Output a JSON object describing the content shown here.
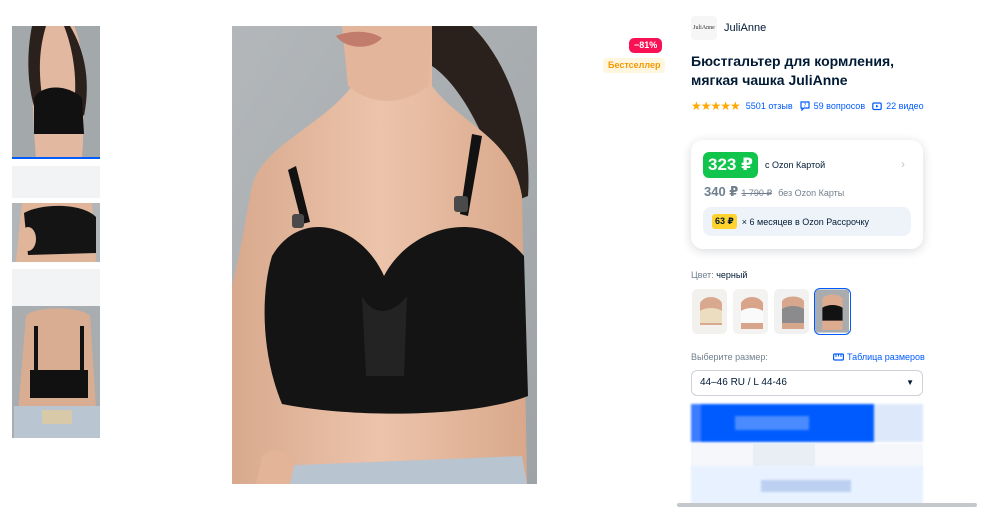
{
  "badges": {
    "discount": "−81%",
    "bestseller": "Бестселлер"
  },
  "brand": {
    "logo_text": "JuliAnne",
    "name": "JuliAnne"
  },
  "product": {
    "title": "Бюстгальтер для кормления, мягкая чашка JuliAnne",
    "rating_stars": "★★★★★",
    "reviews": "5501 отзыв",
    "questions": "59 вопросов",
    "videos": "22 видео"
  },
  "price": {
    "ozon_card_price": "323 ₽",
    "ozon_card_label": "с Ozon Картой",
    "regular_price": "340 ₽",
    "old_price": "1 790 ₽",
    "regular_label": "без Ozon Карты",
    "installment_amount": "63 ₽",
    "installment_text": "× 6 месяцев в Ozon Рассрочку"
  },
  "color": {
    "label": "Цвет:",
    "value": "черный",
    "options": [
      "beige",
      "white",
      "gray",
      "black"
    ],
    "selected_index": 3
  },
  "size": {
    "label": "Выберите размер:",
    "table_link": "Таблица размеров",
    "selected": "44–46 RU / L 44-46"
  },
  "colors": {
    "accent": "#005bff",
    "ozon_green": "#10c44c",
    "discount": "#f91155",
    "star": "#ffa800"
  }
}
